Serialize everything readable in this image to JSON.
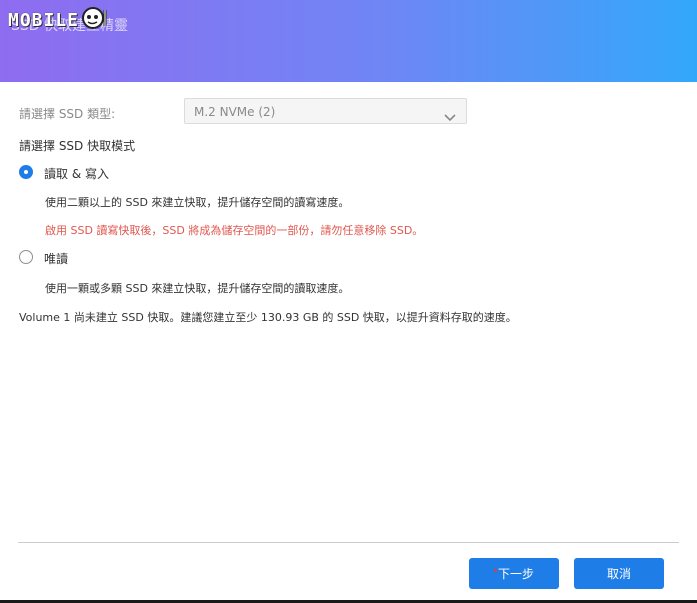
{
  "header": {
    "title": "SSD 快取建立精靈",
    "logo_text": "MOBILE"
  },
  "form": {
    "type_label": "請選擇 SSD 類型:",
    "type_value": "M.2 NVMe (2)",
    "mode_label": "請選擇 SSD 快取模式",
    "options": [
      {
        "label": "讀取 & 寫入",
        "selected": true,
        "description": "使用二顆以上的 SSD 來建立快取，提升儲存空間的讀寫速度。",
        "warning": "啟用 SSD 讀寫快取後，SSD 將成為儲存空間的一部份，請勿任意移除 SSD。"
      },
      {
        "label": "唯讀",
        "selected": false,
        "description": "使用一顆或多顆 SSD 來建立快取，提升儲存空間的讀取速度。"
      }
    ],
    "summary": "Volume 1 尚未建立 SSD 快取。建議您建立至少 130.93 GB 的 SSD 快取，以提升資料存取的速度。"
  },
  "footer": {
    "next_label": "下一步",
    "cancel_label": "取消"
  },
  "colors": {
    "accent": "#1f7de8",
    "warning": "#e0584f",
    "header_start": "#8f6cf0",
    "header_end": "#33a8fb"
  },
  "icons": {
    "select": "chevron-down-icon",
    "logo": "robot-face-icon"
  }
}
